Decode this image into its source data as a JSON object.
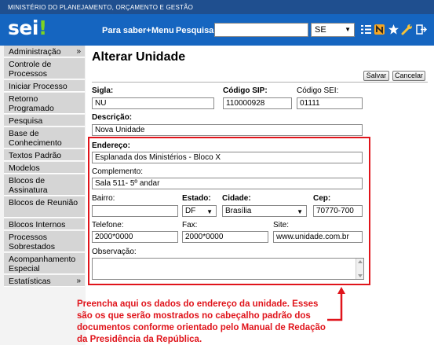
{
  "header": {
    "ministry": "MINISTÉRIO DO PLANEJAMENTO, ORÇAMENTO E GESTÃO",
    "logo_text": "sei",
    "logo_mark": "!",
    "para_saber": "Para saber+",
    "menu": "Menu",
    "pesquisa": "Pesquisa",
    "search_value": "",
    "unit_value": "SE",
    "icons": [
      "list-icon",
      "notes-icon",
      "star-icon",
      "wrench-icon",
      "exit-icon"
    ]
  },
  "sidebar": {
    "items": [
      {
        "label": "Administração",
        "chevron": "»"
      },
      {
        "label": "Controle de Processos"
      },
      {
        "label": "Iniciar Processo"
      },
      {
        "label": "Retorno Programado"
      },
      {
        "label": "Pesquisa"
      },
      {
        "label": "Base de Conhecimento"
      },
      {
        "label": "Textos Padrão"
      },
      {
        "label": "Modelos"
      },
      {
        "label": "Blocos de Assinatura"
      },
      {
        "label": "Blocos de Reunião"
      },
      {
        "label": "Blocos Internos"
      },
      {
        "label": "Processos Sobrestados"
      },
      {
        "label": "Acompanhamento Especial"
      },
      {
        "label": "Estatísticas",
        "chevron": "»"
      }
    ]
  },
  "main": {
    "title": "Alterar Unidade",
    "save_label": "Salvar",
    "cancel_label": "Cancelar",
    "sigla_label": "Sigla:",
    "sigla_value": "NU",
    "codigo_sip_label": "Código SIP:",
    "codigo_sip_value": "110000928",
    "codigo_sei_label": "Código SEI:",
    "codigo_sei_value": "01111",
    "descricao_label": "Descrição:",
    "descricao_value": "Nova Unidade",
    "endereco_label": "Endereço:",
    "endereco_value": "Esplanada dos Ministérios - Bloco X",
    "complemento_label": "Complemento:",
    "complemento_value": "Sala 511- 5º andar",
    "bairro_label": "Bairro:",
    "bairro_value": "",
    "estado_label": "Estado:",
    "estado_value": "DF",
    "cidade_label": "Cidade:",
    "cidade_value": "Brasília",
    "cep_label": "Cep:",
    "cep_value": "70770-700",
    "telefone_label": "Telefone:",
    "telefone_value": "2000*0000",
    "fax_label": "Fax:",
    "fax_value": "2000*0000",
    "site_label": "Site:",
    "site_value": "www.unidade.com.br",
    "observacao_label": "Observação:",
    "observacao_value": ""
  },
  "annotation": {
    "text": "Preencha aqui os dados do endereço da unidade. Esses são os que serão mostrados no cabeçalho padrão dos documentos conforme orientado pelo Manual de Redação da Presidência da República.",
    "color": "#e0141b"
  }
}
